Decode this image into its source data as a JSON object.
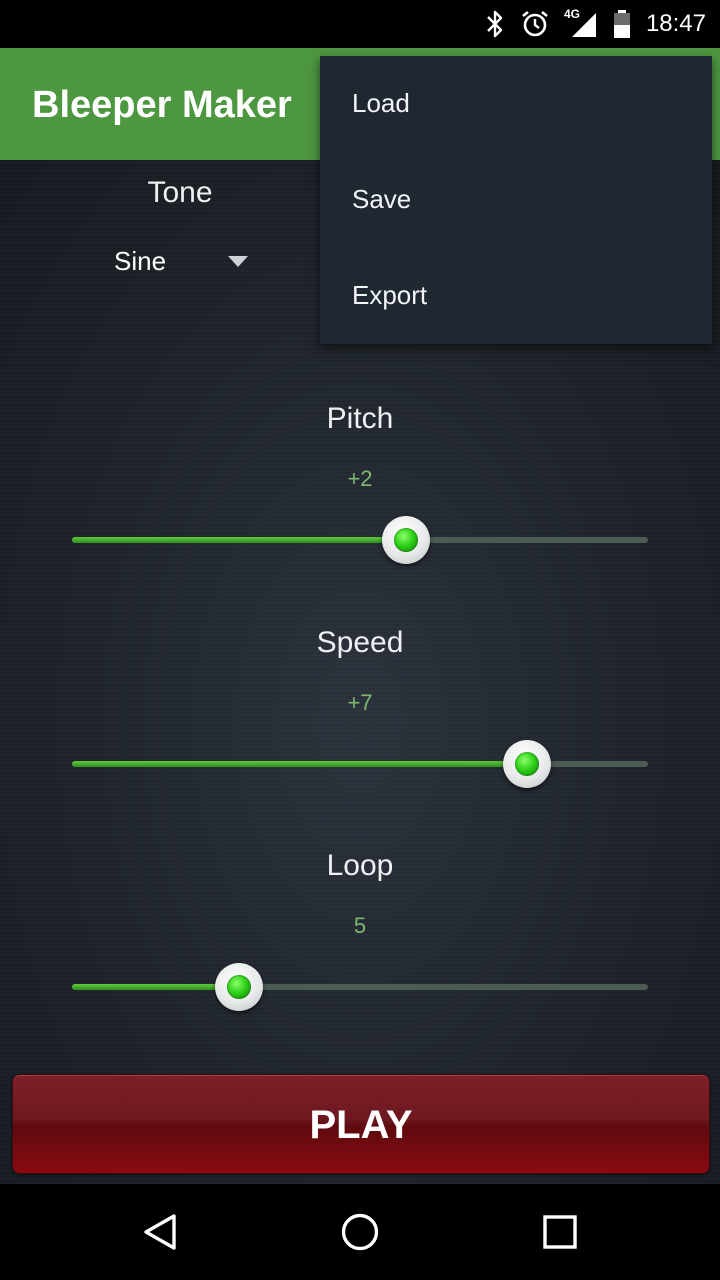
{
  "status_bar": {
    "time": "18:47",
    "network": "4G",
    "icons": [
      "bluetooth-icon",
      "alarm-icon",
      "cell-signal-icon",
      "battery-icon"
    ]
  },
  "app": {
    "title": "Bleeper Maker",
    "accent_color": "#4e9741"
  },
  "tone": {
    "label": "Tone",
    "selected": "Sine"
  },
  "sliders": [
    {
      "label": "Pitch",
      "value_text": "+2",
      "level": 0.58
    },
    {
      "label": "Speed",
      "value_text": "+7",
      "level": 0.79
    },
    {
      "label": "Loop",
      "value_text": "5",
      "level": 0.29
    }
  ],
  "play_button": {
    "label": "PLAY",
    "color": "#8a0a10"
  },
  "overflow_menu": {
    "items": [
      "Load",
      "Save",
      "Export"
    ]
  },
  "nav_bar": {
    "icons": [
      "back-icon",
      "home-icon",
      "recents-icon"
    ]
  }
}
